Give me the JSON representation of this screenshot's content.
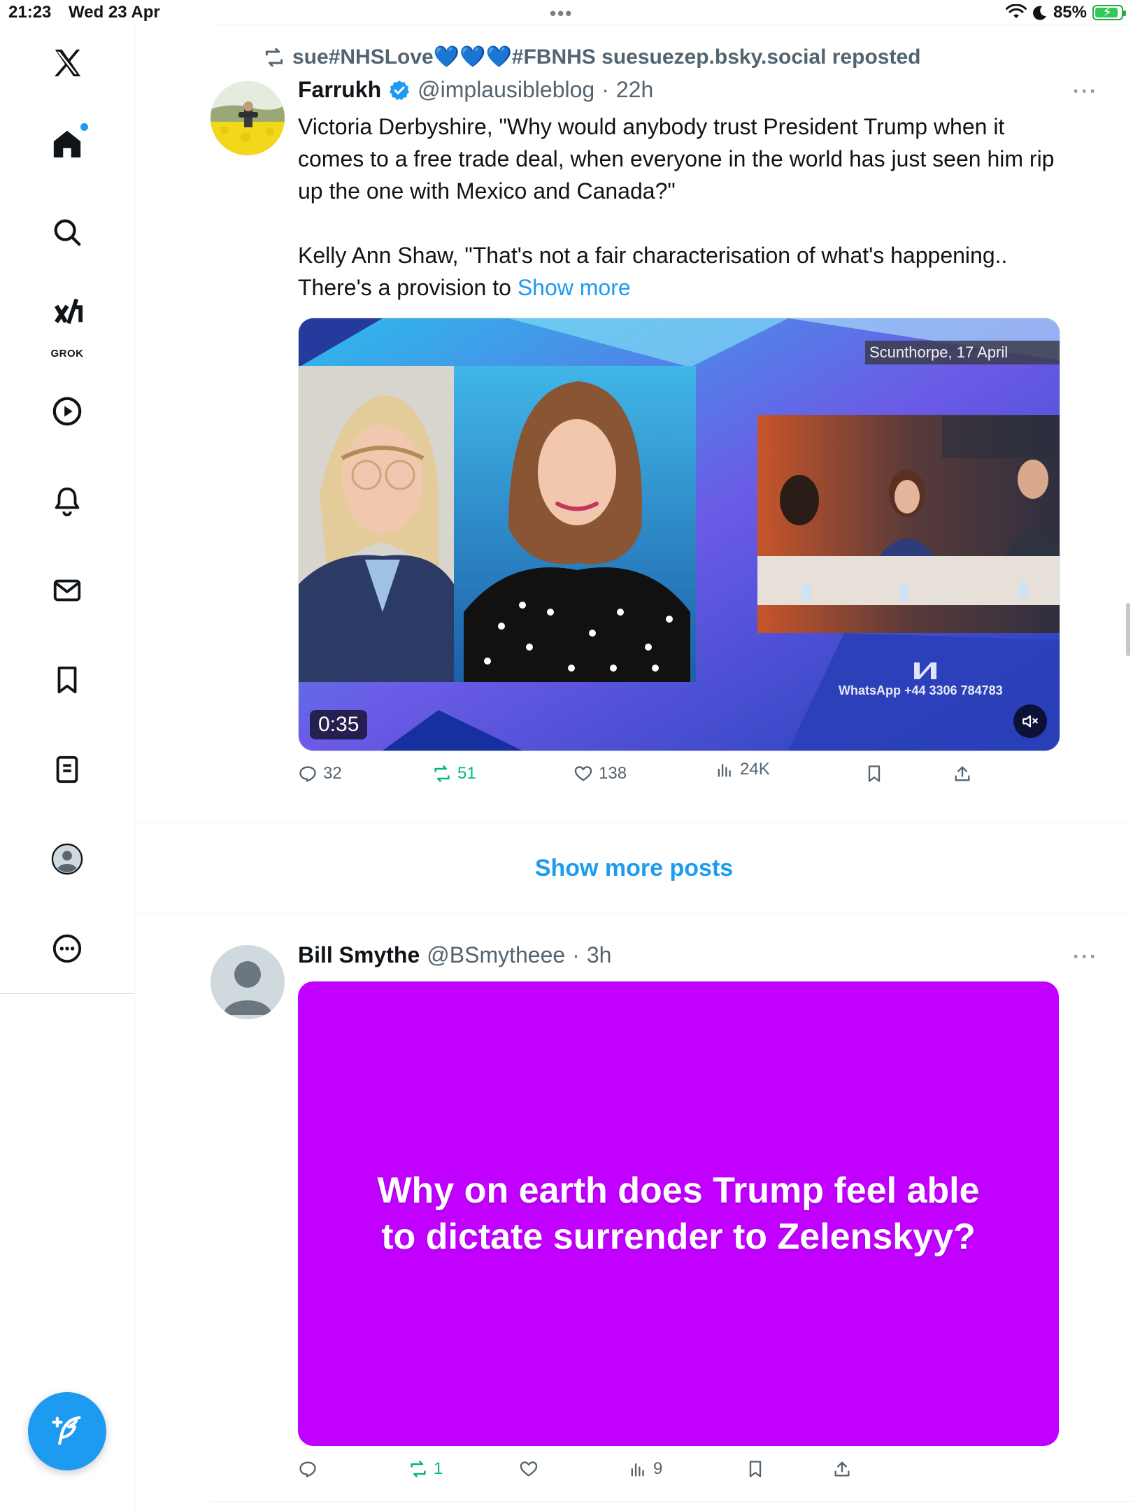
{
  "status_bar": {
    "time": "21:23",
    "date": "Wed 23 Apr",
    "multitask_dots": "•••",
    "battery_percent": "85%",
    "icons": [
      "wifi-icon",
      "moon-icon",
      "battery-charging-icon"
    ]
  },
  "sidebar": {
    "items": [
      {
        "name": "x-logo",
        "icon": "x-logo-icon"
      },
      {
        "name": "home",
        "icon": "home-icon",
        "has_notification_dot": true
      },
      {
        "name": "explore",
        "icon": "search-icon"
      },
      {
        "name": "grok",
        "icon": "grok-icon",
        "label": "GROK"
      },
      {
        "name": "videos",
        "icon": "play-circle-icon"
      },
      {
        "name": "notifications",
        "icon": "bell-icon"
      },
      {
        "name": "messages",
        "icon": "envelope-icon"
      },
      {
        "name": "bookmarks",
        "icon": "bookmark-icon"
      },
      {
        "name": "lists",
        "icon": "list-doc-icon"
      },
      {
        "name": "profile",
        "icon": "profile-avatar-icon"
      },
      {
        "name": "more",
        "icon": "more-circle-icon"
      }
    ],
    "compose_icon": "compose-feather-icon"
  },
  "posts": [
    {
      "repost_banner": "sue#NHSLove💙💙💙#FBNHS suesuezep.bsky.social reposted",
      "author": "Farrukh",
      "verified": true,
      "handle": "@implausibleblog",
      "separator": "·",
      "time": "22h",
      "more": "···",
      "text_p1": "Victoria Derbyshire, \"Why would anybody trust President Trump when it comes to a free trade deal, when everyone in the world has just seen him rip up the one with Mexico and Canada?\"",
      "text_p2": "Kelly Ann Shaw, \"That's not a fair characterisation of what's happening.. There's a provision to ",
      "show_more": "Show more",
      "video": {
        "duration": "0:35",
        "overlay_location": "Scunthorpe, 17 April",
        "overlay_whatsapp": "WhatsApp +44 3306 784783",
        "mute_icon": "speaker-muted-icon"
      },
      "actions": {
        "replies": "32",
        "reposts": "51",
        "likes": "138",
        "views": "24K"
      }
    },
    {
      "author": "Bill Smythe",
      "handle": "@BSmytheee",
      "separator": "·",
      "time": "3h",
      "more": "···",
      "card_text": "Why on earth does Trump feel able to dictate surrender to Zelenskyy?",
      "card_color": "#c100ff",
      "actions": {
        "replies": "",
        "reposts": "1",
        "likes": "",
        "views": "9"
      }
    }
  ],
  "show_more_posts": "Show more posts",
  "colors": {
    "accent": "#1d9bf0",
    "repost_green": "#00ba7c",
    "muted_text": "#536471"
  }
}
